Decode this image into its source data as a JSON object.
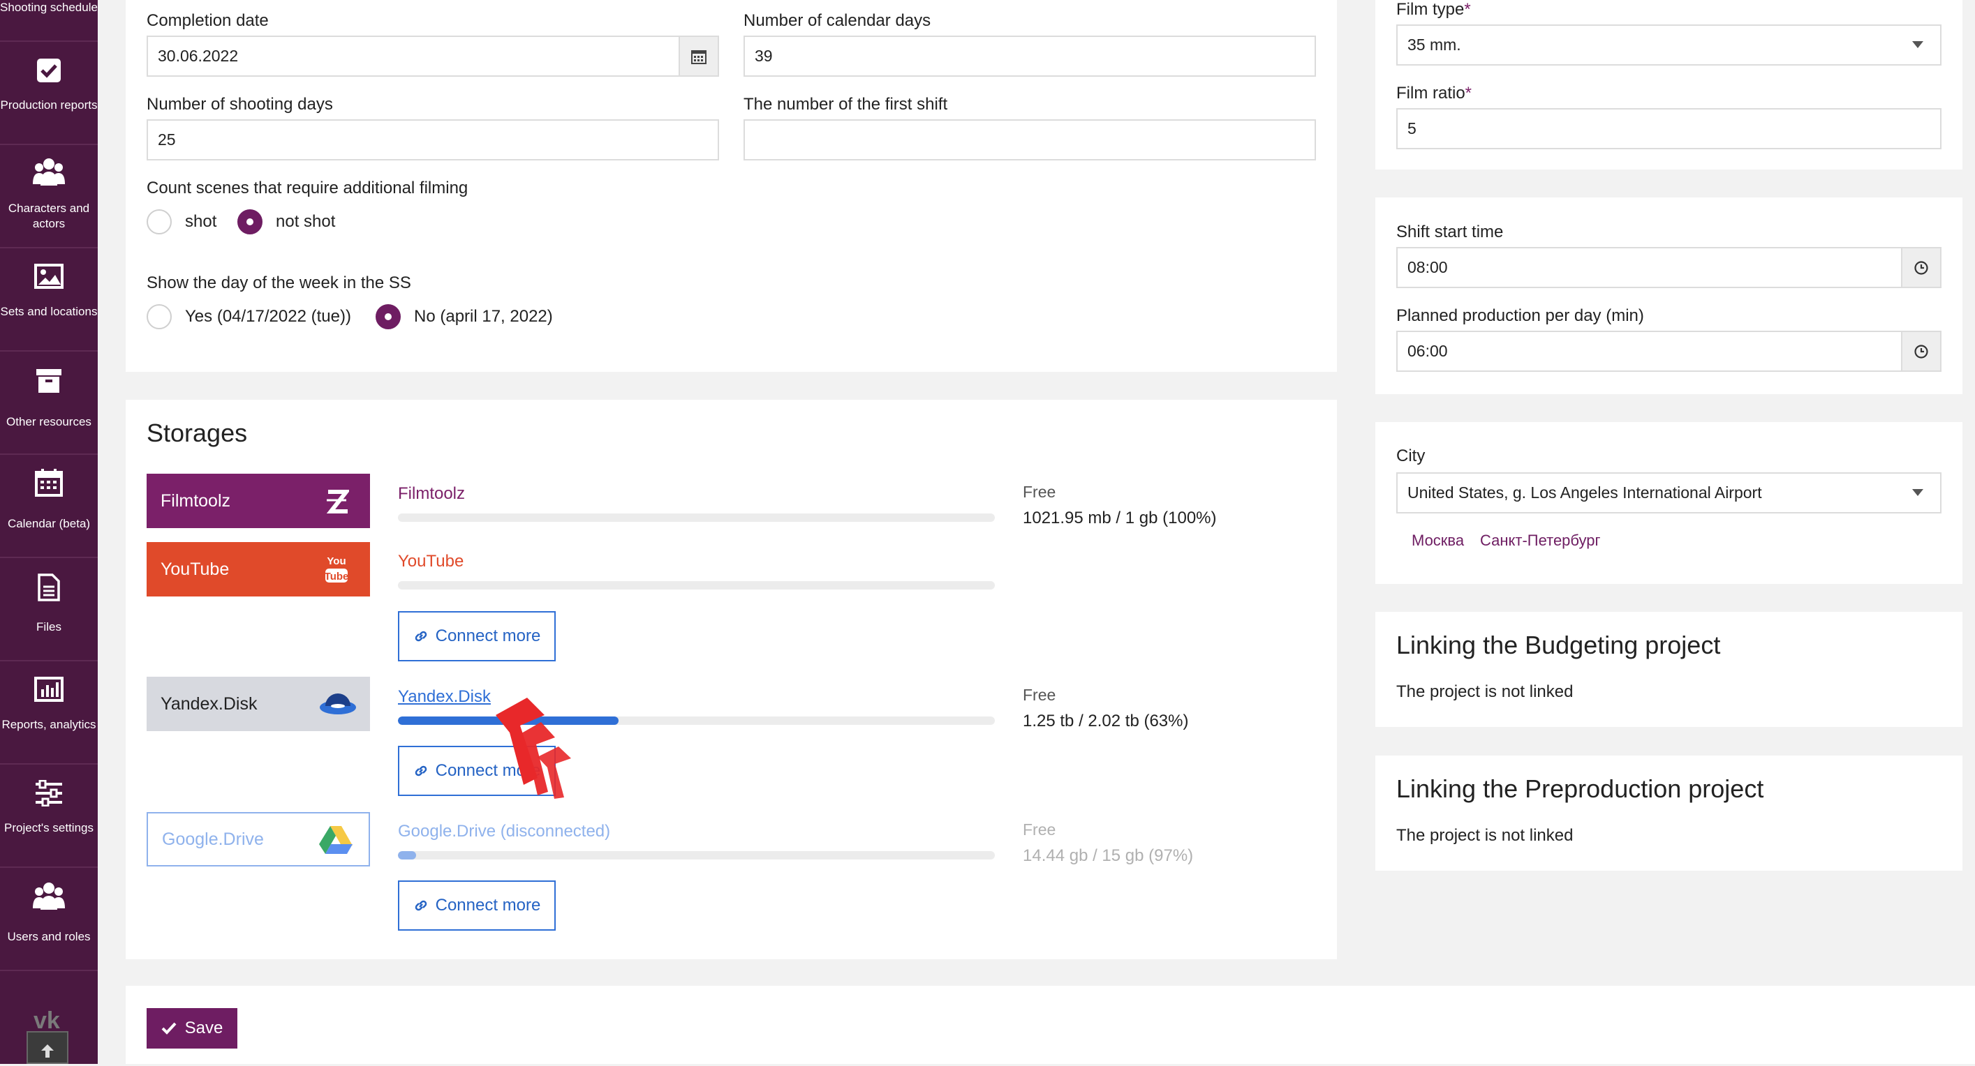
{
  "sidebar": {
    "items": [
      {
        "label": "Shooting schedule",
        "icon": "film-schedule-icon"
      },
      {
        "label": "Production reports",
        "icon": "checkbox-icon"
      },
      {
        "label": "Characters and actors",
        "icon": "users-icon"
      },
      {
        "label": "Sets and locations",
        "icon": "image-icon"
      },
      {
        "label": "Other resources",
        "icon": "archive-icon"
      },
      {
        "label": "Calendar (beta)",
        "icon": "calendar-icon"
      },
      {
        "label": "Files",
        "icon": "file-icon"
      },
      {
        "label": "Reports, analytics",
        "icon": "bar-chart-icon"
      },
      {
        "label": "Project's settings",
        "icon": "sliders-icon"
      },
      {
        "label": "Users and roles",
        "icon": "users-icon"
      }
    ],
    "vk": "vk",
    "scroll_top_icon": "arrow-up-icon"
  },
  "settings": {
    "completion_date_label": "Completion date",
    "completion_date_value": "30.06.2022",
    "calendar_days_label": "Number of calendar days",
    "calendar_days_value": "39",
    "shooting_days_label": "Number of shooting days",
    "shooting_days_value": "25",
    "first_shift_label": "The number of the first shift",
    "first_shift_value": "",
    "count_scenes_label": "Count scenes that require additional filming",
    "count_scenes_options": [
      {
        "label": "shot",
        "selected": false
      },
      {
        "label": "not shot",
        "selected": true
      }
    ],
    "day_of_week_label": "Show the day of the week in the SS",
    "day_of_week_options": [
      {
        "label": "Yes (04/17/2022 (tue))",
        "selected": false
      },
      {
        "label": "No (april 17, 2022)",
        "selected": true
      }
    ]
  },
  "storages": {
    "title": "Storages",
    "items": [
      {
        "badge": "Filmtoolz",
        "name": "Filmtoolz",
        "free_label": "Free",
        "free_value": "1021.95 mb / 1 gb (100%)",
        "usage_fraction": 0.0,
        "color": "#7b2069"
      },
      {
        "badge": "YouTube",
        "name": "YouTube",
        "free_label": "",
        "free_value": "",
        "usage_fraction": 0.0,
        "color": "#e04a2a",
        "connect": "Connect more"
      },
      {
        "badge": "Yandex.Disk",
        "name": "Yandex.Disk",
        "free_label": "Free",
        "free_value": "1.25 tb / 2.02 tb (63%)",
        "usage_fraction": 0.37,
        "color": "#2f6fd6",
        "connect": "Connect more"
      },
      {
        "badge": "Google.Drive",
        "name": "Google.Drive (disconnected)",
        "free_label": "Free",
        "free_value": "14.44 gb / 15 gb (97%)",
        "usage_fraction": 0.03,
        "color": "#8fb2ec",
        "connect": "Connect more"
      }
    ]
  },
  "right": {
    "film_type_label": "Film type",
    "film_type_value": "35 mm.",
    "film_ratio_label": "Film ratio",
    "film_ratio_value": "5",
    "required_mark": "*",
    "shift_start_label": "Shift start time",
    "shift_start_value": "08:00",
    "planned_label": "Planned production per day (min)",
    "planned_value": "06:00",
    "city_label": "City",
    "city_value": "United States, g. Los Angeles International Airport",
    "city_links": [
      "Москва",
      "Санкт-Петербург"
    ],
    "budget_title": "Linking the Budgeting project",
    "budget_status": "The project is not linked",
    "preprod_title": "Linking the Preproduction project",
    "preprod_status": "The project is not linked"
  },
  "actions": {
    "save_label": "Save"
  }
}
